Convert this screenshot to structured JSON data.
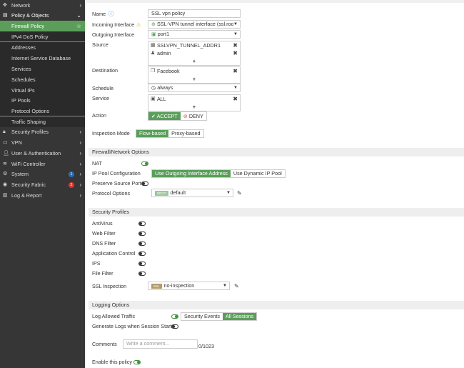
{
  "sidebar": {
    "items": [
      {
        "label": "Network",
        "icon": "network-icon"
      },
      {
        "label": "Policy & Objects",
        "icon": "policy-icon"
      },
      {
        "label": "Firewall Policy"
      },
      {
        "label": "IPv4 DoS Policy"
      },
      {
        "label": "Addresses"
      },
      {
        "label": "Internet Service Database"
      },
      {
        "label": "Services"
      },
      {
        "label": "Schedules"
      },
      {
        "label": "Virtual IPs"
      },
      {
        "label": "IP Pools"
      },
      {
        "label": "Protocol Options"
      },
      {
        "label": "Traffic Shaping"
      },
      {
        "label": "Security Profiles"
      },
      {
        "label": "VPN"
      },
      {
        "label": "User & Authentication"
      },
      {
        "label": "WiFi Controller"
      },
      {
        "label": "System",
        "badge": "1"
      },
      {
        "label": "Security Fabric",
        "badge": "2"
      },
      {
        "label": "Log & Report"
      }
    ]
  },
  "form": {
    "name_label": "Name",
    "name_value": "SSL vpn policy",
    "incoming_label": "Incoming Interface",
    "incoming_value": "SSL-VPN tunnel interface (ssl.root)",
    "outgoing_label": "Outgoing Interface",
    "outgoing_value": "port1",
    "source_label": "Source",
    "source_items": [
      "SSLVPN_TUNNEL_ADDR1",
      "admin"
    ],
    "destination_label": "Destination",
    "destination_items": [
      "Facebook"
    ],
    "schedule_label": "Schedule",
    "schedule_value": "always",
    "service_label": "Service",
    "service_items": [
      "ALL"
    ],
    "plus": "+",
    "action_label": "Action",
    "accept": "ACCEPT",
    "deny": "DENY",
    "inspection_label": "Inspection Mode",
    "flow": "Flow-based",
    "proxy": "Proxy-based"
  },
  "firewall": {
    "header": "Firewall/Network Options",
    "nat": "NAT",
    "ippool_label": "IP Pool Configuration",
    "ippool_opt1": "Use Outgoing Interface Address",
    "ippool_opt2": "Use Dynamic IP Pool",
    "preserve": "Preserve Source Port",
    "protocol_label": "Protocol Options",
    "protocol_tag": "PROT",
    "protocol_value": "default"
  },
  "security": {
    "header": "Security Profiles",
    "items": [
      "AntiVirus",
      "Web Filter",
      "DNS Filter",
      "Application Control",
      "IPS",
      "File Filter"
    ],
    "ssl_label": "SSL Inspection",
    "ssl_tag": "SSL",
    "ssl_value": "no-inspection"
  },
  "logging": {
    "header": "Logging Options",
    "log_allowed": "Log Allowed Traffic",
    "opt1": "Security Events",
    "opt2": "All Sessions",
    "generate": "Generate Logs when Session Starts",
    "comments_label": "Comments",
    "comments_placeholder": "Write a comment...",
    "comments_count": "0/1023",
    "enable": "Enable this policy"
  },
  "colors": {
    "accent": "#5a9e5a",
    "sidebar": "#363636"
  }
}
